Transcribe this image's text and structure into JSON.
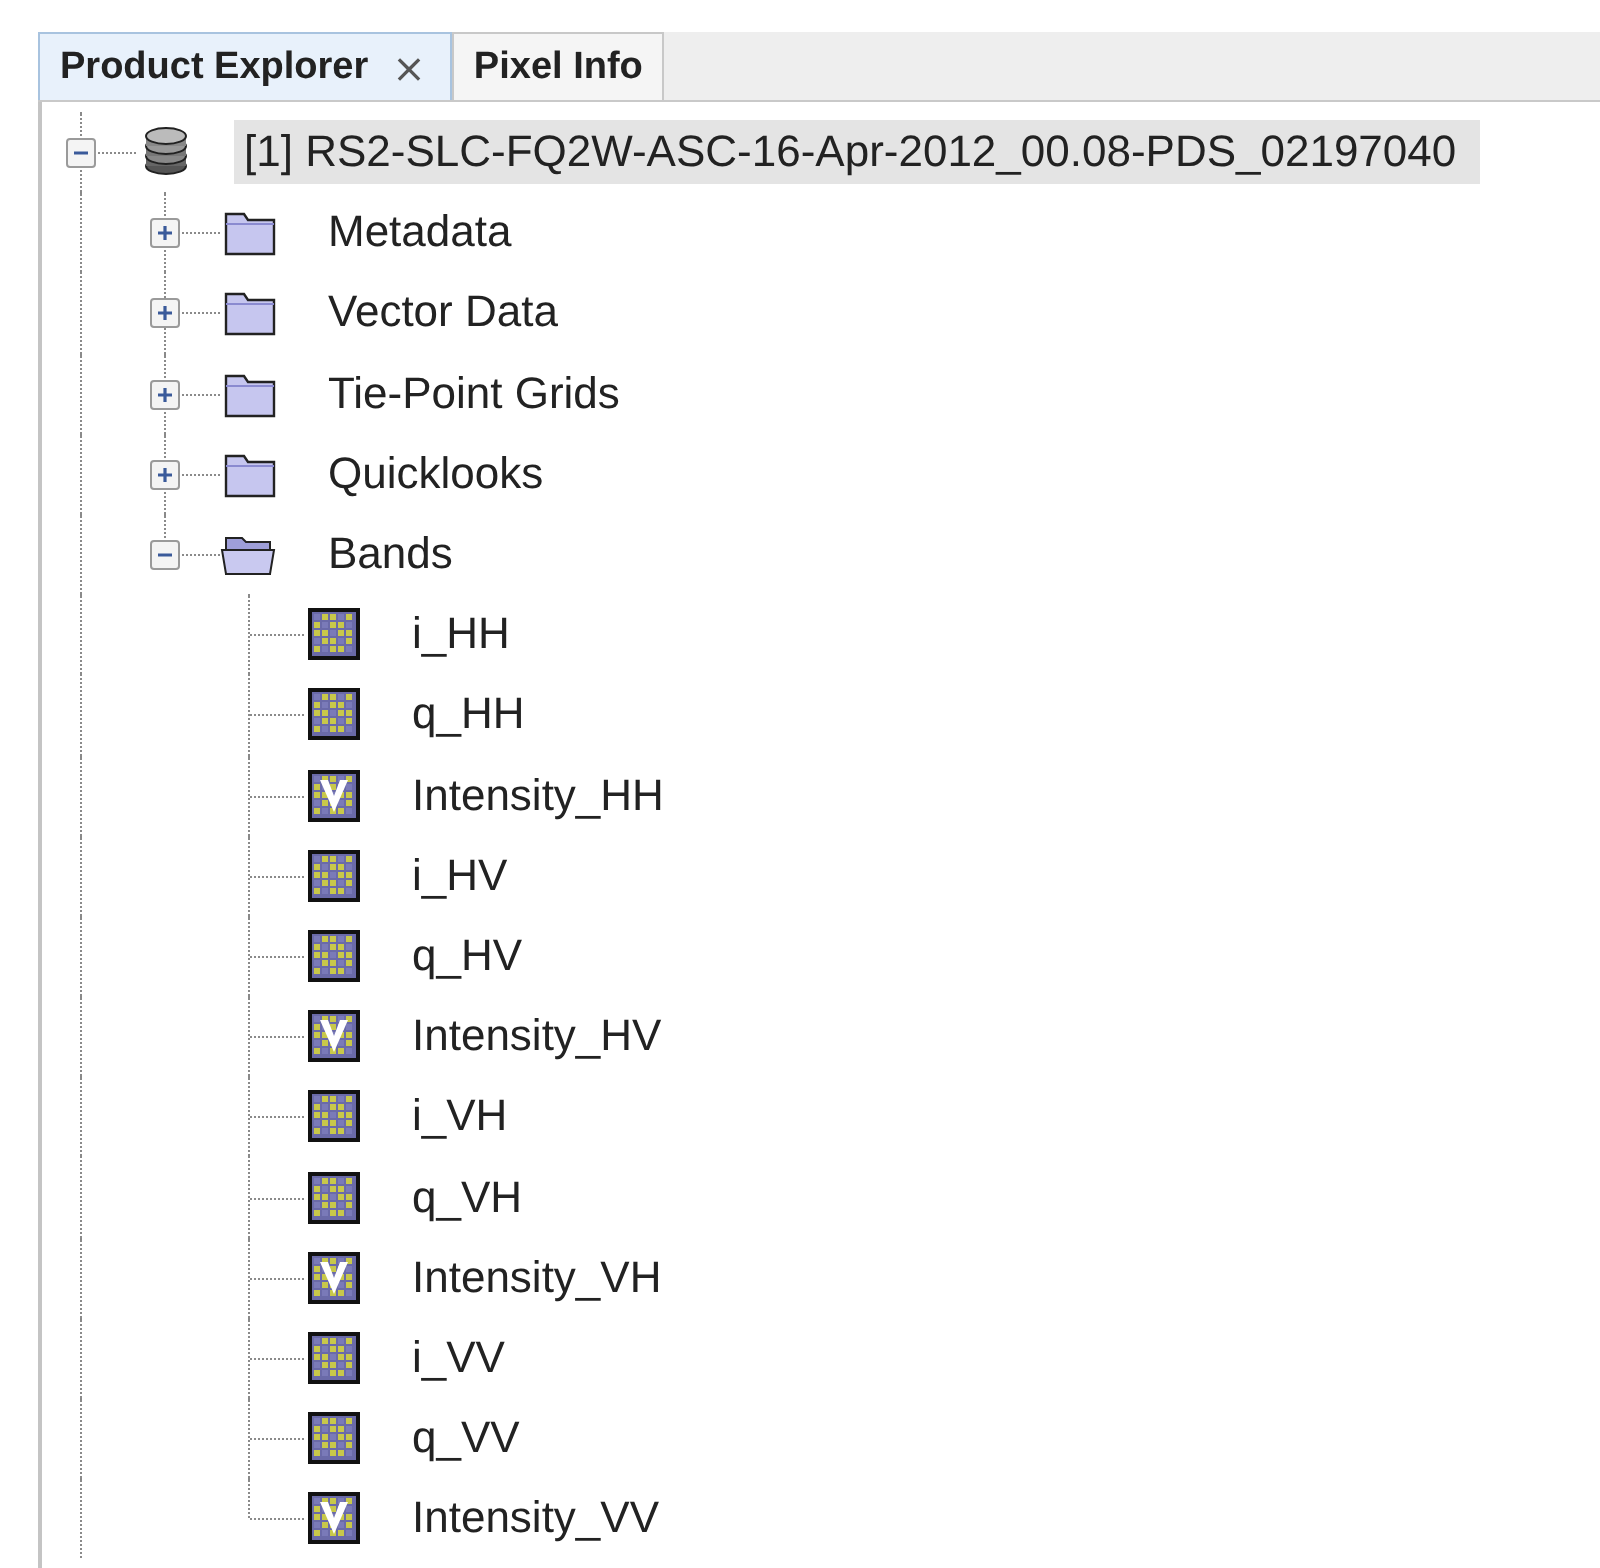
{
  "tabs": [
    {
      "label": "Product Explorer",
      "selected": true,
      "close": "×"
    },
    {
      "label": "Pixel Info",
      "selected": false
    }
  ],
  "tree": [
    {
      "kind": "product",
      "label": "[1] RS2-SLC-FQ2W-ASC-16-Apr-2012_00.08-PDS_02197040",
      "selected": true,
      "expanded": true,
      "children": [
        {
          "kind": "folder",
          "label": "Metadata",
          "selected": false,
          "expanded": false
        },
        {
          "kind": "folder",
          "label": "Vector Data",
          "selected": false,
          "expanded": false
        },
        {
          "kind": "folder",
          "label": "Tie-Point Grids",
          "selected": false,
          "expanded": false
        },
        {
          "kind": "folder",
          "label": "Quicklooks",
          "selected": false,
          "expanded": false
        },
        {
          "kind": "folder",
          "label": "Bands",
          "selected": false,
          "expanded": true,
          "children": [
            {
              "kind": "band",
              "label": "i_HH",
              "selected": false
            },
            {
              "kind": "band",
              "label": "q_HH",
              "selected": false
            },
            {
              "kind": "virtual_band",
              "label": "Intensity_HH",
              "selected": false
            },
            {
              "kind": "band",
              "label": "i_HV",
              "selected": false
            },
            {
              "kind": "band",
              "label": "q_HV",
              "selected": false
            },
            {
              "kind": "virtual_band",
              "label": "Intensity_HV",
              "selected": false
            },
            {
              "kind": "band",
              "label": "i_VH",
              "selected": false
            },
            {
              "kind": "band",
              "label": "q_VH",
              "selected": false
            },
            {
              "kind": "virtual_band",
              "label": "Intensity_VH",
              "selected": false
            },
            {
              "kind": "band",
              "label": "i_VV",
              "selected": false
            },
            {
              "kind": "band",
              "label": "q_VV",
              "selected": false
            },
            {
              "kind": "virtual_band",
              "label": "Intensity_VV",
              "selected": false
            }
          ]
        }
      ]
    }
  ]
}
